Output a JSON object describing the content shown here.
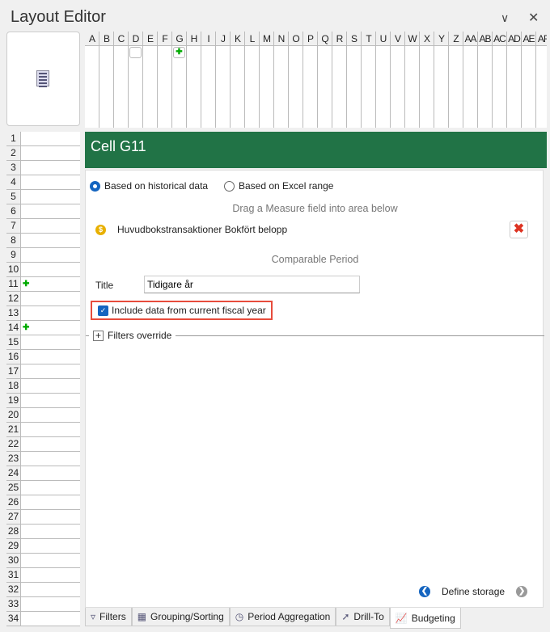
{
  "window": {
    "title": "Layout Editor"
  },
  "columns": [
    "A",
    "B",
    "C",
    "D",
    "E",
    "F",
    "G",
    "H",
    "I",
    "J",
    "K",
    "L",
    "M",
    "N",
    "O",
    "P",
    "Q",
    "R",
    "S",
    "T",
    "U",
    "V",
    "W",
    "X",
    "Y",
    "Z",
    "AA",
    "AB",
    "AC",
    "AD",
    "AE",
    "AF"
  ],
  "rows": [
    "1",
    "2",
    "3",
    "4",
    "5",
    "6",
    "7",
    "8",
    "9",
    "10",
    "11",
    "12",
    "13",
    "14",
    "15",
    "16",
    "17",
    "18",
    "19",
    "20",
    "21",
    "22",
    "23",
    "24",
    "25",
    "26",
    "27",
    "28",
    "29",
    "30",
    "31",
    "32",
    "33",
    "34"
  ],
  "cell": {
    "header": "Cell G11"
  },
  "source": {
    "options": [
      "Based on historical data",
      "Based on Excel range"
    ],
    "selected": "Based on historical data"
  },
  "drag_hint": "Drag a Measure field into area below",
  "measure": "Huvudbokstransaktioner Bokfört belopp",
  "comparable_period": "Comparable Period",
  "title_label": "Title",
  "title_value": "Tidigare år",
  "include_current": {
    "label": "Include data from current fiscal year",
    "checked": true
  },
  "filters_override": "Filters override",
  "define_storage": "Define storage",
  "tabs": [
    "Filters",
    "Grouping/Sorting",
    "Period Aggregation",
    "Drill-To",
    "Budgeting"
  ],
  "active_tab": "Budgeting",
  "colors": {
    "header": "#217346",
    "accent": "#1565c0",
    "highlight": "#e74c3c"
  }
}
